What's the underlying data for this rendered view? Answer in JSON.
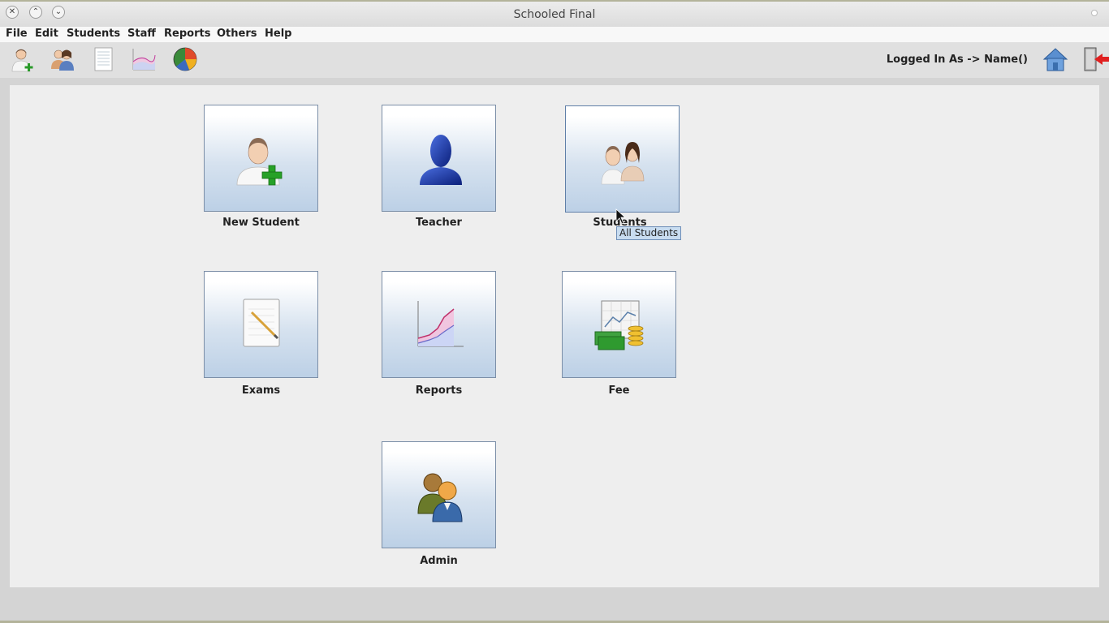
{
  "window": {
    "title": "Schooled Final"
  },
  "menubar": {
    "items": [
      "File",
      "Edit",
      "Students",
      "Staff",
      "Reports",
      "Others",
      "Help"
    ]
  },
  "toolbar": {
    "icons": [
      "add-user-icon",
      "users-icon",
      "document-icon",
      "chart-icon",
      "pie-chart-icon"
    ],
    "login_text": "Logged In As -> Name()",
    "right_icons": [
      "home-icon",
      "logout-icon"
    ]
  },
  "tiles": [
    {
      "label": "New Student",
      "icon": "add-user-icon"
    },
    {
      "label": "Teacher",
      "icon": "teacher-icon"
    },
    {
      "label": "Students",
      "icon": "students-icon"
    },
    {
      "label": "Exams",
      "icon": "exam-paper-icon"
    },
    {
      "label": "Reports",
      "icon": "line-chart-icon"
    },
    {
      "label": "Fee",
      "icon": "money-icon"
    },
    {
      "label": "Admin",
      "icon": "admin-icon"
    }
  ],
  "tooltip": {
    "text": "All Students"
  },
  "colors": {
    "tile_top": "#ffffff",
    "tile_bottom": "#bcd0e6",
    "tile_border": "#7b8ea7",
    "tooltip_bg": "#c8dcf0"
  }
}
